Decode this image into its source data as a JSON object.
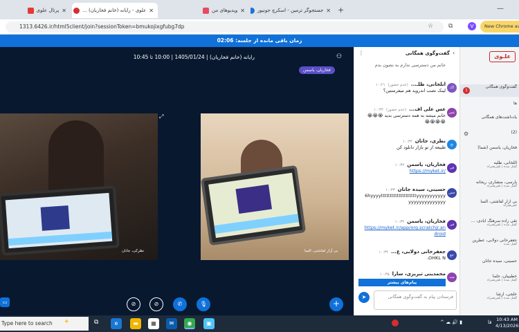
{
  "tabs": [
    {
      "title": "پرتال علوی",
      "active": false
    },
    {
      "title": "علوی - رایانه (خانم فخاریان) ...",
      "active": true
    },
    {
      "title": "ویدیوهای من",
      "active": false
    },
    {
      "title": "جستجوگر ترمین - اسکرچ جونیور",
      "active": false
    }
  ],
  "browser": {
    "url": "1313.6426.ir/html5client/join?sessionToken=bmukojixgfubg7dp",
    "chrome_label": "New Chrome ava"
  },
  "banner": {
    "text": "زمان باقی مانده از جلسه: 02:06"
  },
  "meeting": {
    "title": "رایانه (خانم فخاریان) | 1405/01/24 | 10:00 تا 10:45",
    "presenter_tag": "فخاریان، یاسمن",
    "video_left_label": "نظرکی، جانان",
    "video_right_label": "بی آزار لفاشتی، السا"
  },
  "chat": {
    "title": "گفت‌وگوی همگانی",
    "top_text": "خانم من دسترسی ندارم به نشون بدم",
    "messages": [
      {
        "name": "انلخانی، ظلـ...",
        "status": "(عدم حضور)",
        "time": "۱۰:۲۱",
        "text": "لینک نصب اندروید هم میفرستین؟",
        "initials": "اک",
        "color": "#7e57c2"
      },
      {
        "name": "عس علی اف...",
        "status": "(عدم حضور)",
        "time": "۱۰:۳۲",
        "text": "خانم میشه به همه دسترسی بدید 😭😭😭😭😭😭😭",
        "initials": "عس",
        "color": "#8e44ad"
      },
      {
        "name": "نظری، جانان",
        "status": "",
        "time": "۱۰:۳۲",
        "text": "طبیعه از تو بازار دانلود کن",
        "initials": "نج",
        "color": "#1e88e5"
      },
      {
        "name": "فخاریان، یاسمن",
        "status": "",
        "time": "۱۰:۳۲",
        "text": "https://myket.ir/",
        "initials": "فی",
        "color": "#5e35b1",
        "link": true
      },
      {
        "name": "حسینی، سیده جانان",
        "status": "",
        "time": "۱۰:۳۳",
        "text": "6hyyyyttttttttttttttttttttyyyyyyyyyyyyyyyyyyyyyyyyy",
        "initials": "حس",
        "color": "#3949ab"
      },
      {
        "name": "فخاریان، یاسمن",
        "status": "",
        "time": "۱۰:۳۴",
        "text": "https://myket.ir/app/org.scratchjr.android",
        "initials": "فی",
        "color": "#5e35b1",
        "link": true
      },
      {
        "name": "جعفرخانی دولابی، ع...",
        "status": "",
        "time": "۱۰:۳۴",
        "text": "OHKL N،",
        "initials": "جع",
        "color": "#3949ab"
      },
      {
        "name": "محمدینی تبریزی، سارا",
        "status": "",
        "time": "۱۰:۳۵",
        "text": "",
        "initials": "مت",
        "color": "#8e44ad"
      }
    ],
    "more_button": "پیام‌های بیشتر",
    "input_placeholder": "فرستادن پیام به گفت‌وگوی همگانی"
  },
  "users": {
    "logo": "علـوی",
    "items": [
      {
        "label": "گفت‌وگوی همگانی",
        "badge": "1",
        "sub": ""
      },
      {
        "label": "ها",
        "sub": ""
      },
      {
        "label": "یادداشت‌های همگانی",
        "sub": ""
      },
      {
        "label": "(2)",
        "sub": ""
      },
      {
        "label": "فخاریان، یاسمن (شما)",
        "sub": ""
      },
      {
        "label": "اللخانی، ظلیه",
        "sub": "گفتل شده | تلفن‌همراه"
      },
      {
        "label": "پارسی، منشاری، ریحانه",
        "sub": "گفتل شده | تلفن‌همراه"
      },
      {
        "label": "بی آزار لفاشتی، السا",
        "sub": "تلفن‌همراه"
      },
      {
        "label": "تقی زاده سرهنگ آبادی، ...",
        "sub": "گفتل شده | تلفن‌همراه"
      },
      {
        "label": "جعفرخانی دولابی، عطرین",
        "sub": "گفتل شده"
      },
      {
        "label": "حسینی، سیده جانان",
        "sub": ""
      },
      {
        "label": "خطیبیان، حلما",
        "sub": "گفتل شده | تلفن‌همراه"
      },
      {
        "label": "خلجی، آرشا",
        "sub": "گفتل شده | تلفن‌همراه"
      }
    ]
  },
  "taskbar": {
    "search": "Type here to search",
    "lang": "فا",
    "time": "10:43 AM",
    "date": "4/13/2026"
  },
  "colors": {
    "banner": "#0f71d9",
    "stage": "#08182f",
    "accent": "#0f71d9",
    "taskbar": "#1d2b3b"
  }
}
